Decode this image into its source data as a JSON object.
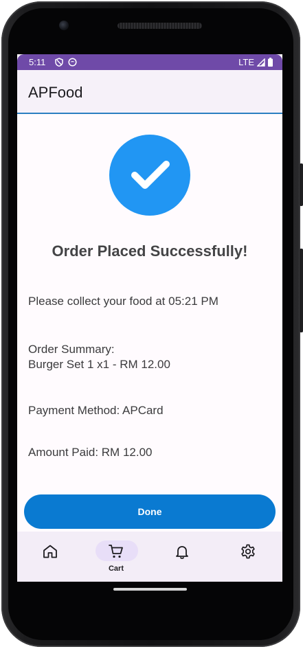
{
  "status_bar": {
    "time": "5:11",
    "network": "LTE"
  },
  "app_bar": {
    "title": "APFood"
  },
  "confirmation": {
    "title": "Order Placed Successfully!",
    "collect_message": "Please collect your food at 05:21 PM",
    "summary_heading": "Order Summary:",
    "summary_item": "Burger Set 1 x1 - RM 12.00",
    "payment_method": "Payment Method: APCard",
    "amount_paid": "Amount Paid: RM 12.00"
  },
  "done_button": {
    "label": "Done"
  },
  "bottom_nav": {
    "items": [
      {
        "icon": "home-icon",
        "label": ""
      },
      {
        "icon": "cart-icon",
        "label": "Cart",
        "selected": true
      },
      {
        "icon": "bell-icon",
        "label": ""
      },
      {
        "icon": "gear-icon",
        "label": ""
      }
    ]
  },
  "colors": {
    "status_bar": "#6f4aa8",
    "accent_blue": "#2196f3",
    "button_blue": "#0a7ad1",
    "nav_background": "#f3edf7",
    "nav_selected_pill": "#e8def8"
  }
}
